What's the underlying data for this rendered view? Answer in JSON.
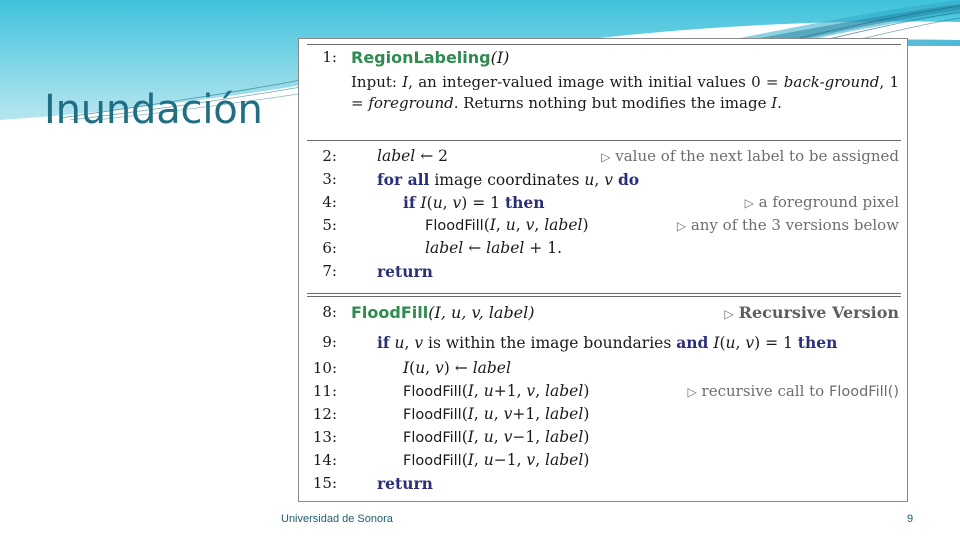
{
  "slide": {
    "title": "Inundación",
    "title_color": "#1F6E84",
    "accent_color": "#5BC8DE",
    "footer": "Universidad de Sonora",
    "page_number": "9"
  },
  "algorithm": {
    "keyword_color": "#2b2f7a",
    "procedure_color": "#2f8b4f",
    "comment_color": "#6d6d6d",
    "sections": [
      {
        "name": "region-labeling",
        "header_line": {
          "num": "1:",
          "proc": "RegionLabeling",
          "args": "(I)"
        },
        "description": "Input: I, an integer-valued image with initial values 0 = background, 1 = foreground. Returns nothing but modifies the image I.",
        "lines": [
          {
            "num": "2:",
            "code": "label ← 2",
            "comment": "value of the next label to be assigned"
          },
          {
            "num": "3:",
            "code": "for all image coordinates u, v do",
            "comment": ""
          },
          {
            "num": "4:",
            "code": "if I(u, v) = 1 then",
            "comment": "a foreground pixel"
          },
          {
            "num": "5:",
            "code": "FloodFill(I, u, v, label)",
            "comment": "any of the 3 versions below"
          },
          {
            "num": "6:",
            "code": "label ← label + 1.",
            "comment": ""
          },
          {
            "num": "7:",
            "code": "return",
            "comment": ""
          }
        ]
      },
      {
        "name": "flood-fill",
        "header_line": {
          "num": "8:",
          "proc": "FloodFill",
          "args": "(I, u, v, label)",
          "comment": "Recursive Version"
        },
        "lines": [
          {
            "num": "9:",
            "code": "if u, v is within the image boundaries and I(u, v) = 1 then",
            "comment": ""
          },
          {
            "num": "10:",
            "code": "I(u, v) ← label",
            "comment": ""
          },
          {
            "num": "11:",
            "code": "FloodFill(I, u+1, v, label)",
            "comment": "recursive call to FloodFill()"
          },
          {
            "num": "12:",
            "code": "FloodFill(I, u, v+1, label)",
            "comment": ""
          },
          {
            "num": "13:",
            "code": "FloodFill(I, u, v−1, label)",
            "comment": ""
          },
          {
            "num": "14:",
            "code": "FloodFill(I, u−1, v, label)",
            "comment": ""
          },
          {
            "num": "15:",
            "code": "return",
            "comment": ""
          }
        ]
      }
    ]
  }
}
